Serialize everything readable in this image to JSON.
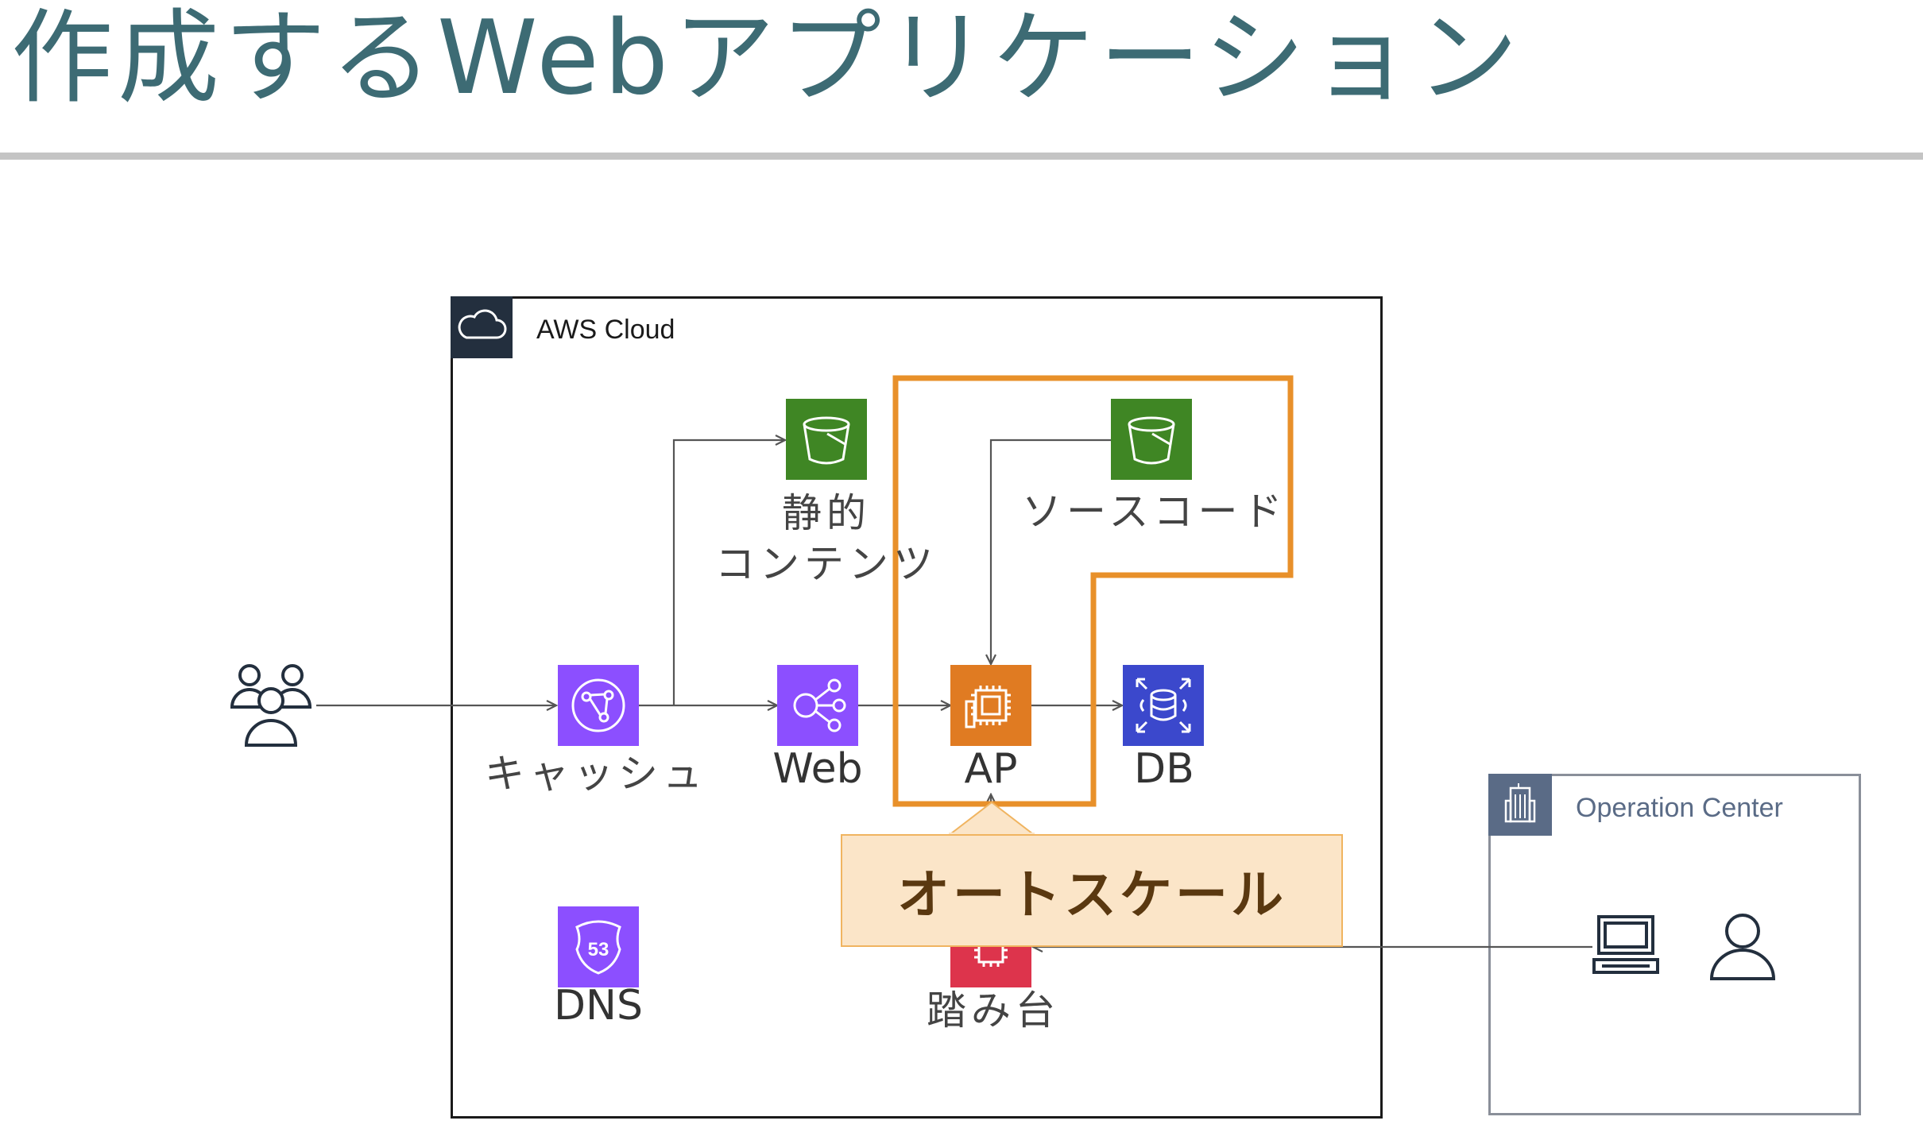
{
  "title": "作成するWebアプリケーション",
  "aws_cloud": {
    "label": "AWS Cloud",
    "badge_icon": "cloud-icon",
    "badge_color": "#232f3e"
  },
  "operation_center": {
    "label": "Operation Center",
    "badge_icon": "building-icon",
    "badge_color": "#5a6b86"
  },
  "nodes": {
    "users": {
      "icon": "users-icon"
    },
    "cache": {
      "label": "キャッシュ",
      "icon": "cloudfront-icon",
      "color": "#8c4fff"
    },
    "static": {
      "label_line1": "静的",
      "label_line2": "コンテンツ",
      "icon": "s3-bucket-icon",
      "color": "#3f8624"
    },
    "web": {
      "label": "Web",
      "icon": "load-balancer-icon",
      "color": "#8c4fff"
    },
    "ap": {
      "label": "AP",
      "icon": "ec2-instance-icon",
      "color": "#e07b22"
    },
    "source": {
      "label": "ソースコード",
      "icon": "s3-bucket-icon",
      "color": "#3f8624"
    },
    "db": {
      "label": "DB",
      "icon": "rds-database-icon",
      "color": "#3b48cc"
    },
    "dns": {
      "label": "DNS",
      "icon": "route53-icon",
      "color": "#8c4fff"
    },
    "bastion": {
      "label": "踏み台",
      "icon": "bastion-ec2-icon",
      "color": "#dd344c"
    },
    "laptop": {
      "icon": "laptop-icon"
    },
    "operator": {
      "icon": "user-icon"
    }
  },
  "callout": {
    "text": "オートスケール",
    "fill": "#fbe5c8",
    "border": "#f0b460"
  },
  "highlight_color": "#e8902a"
}
